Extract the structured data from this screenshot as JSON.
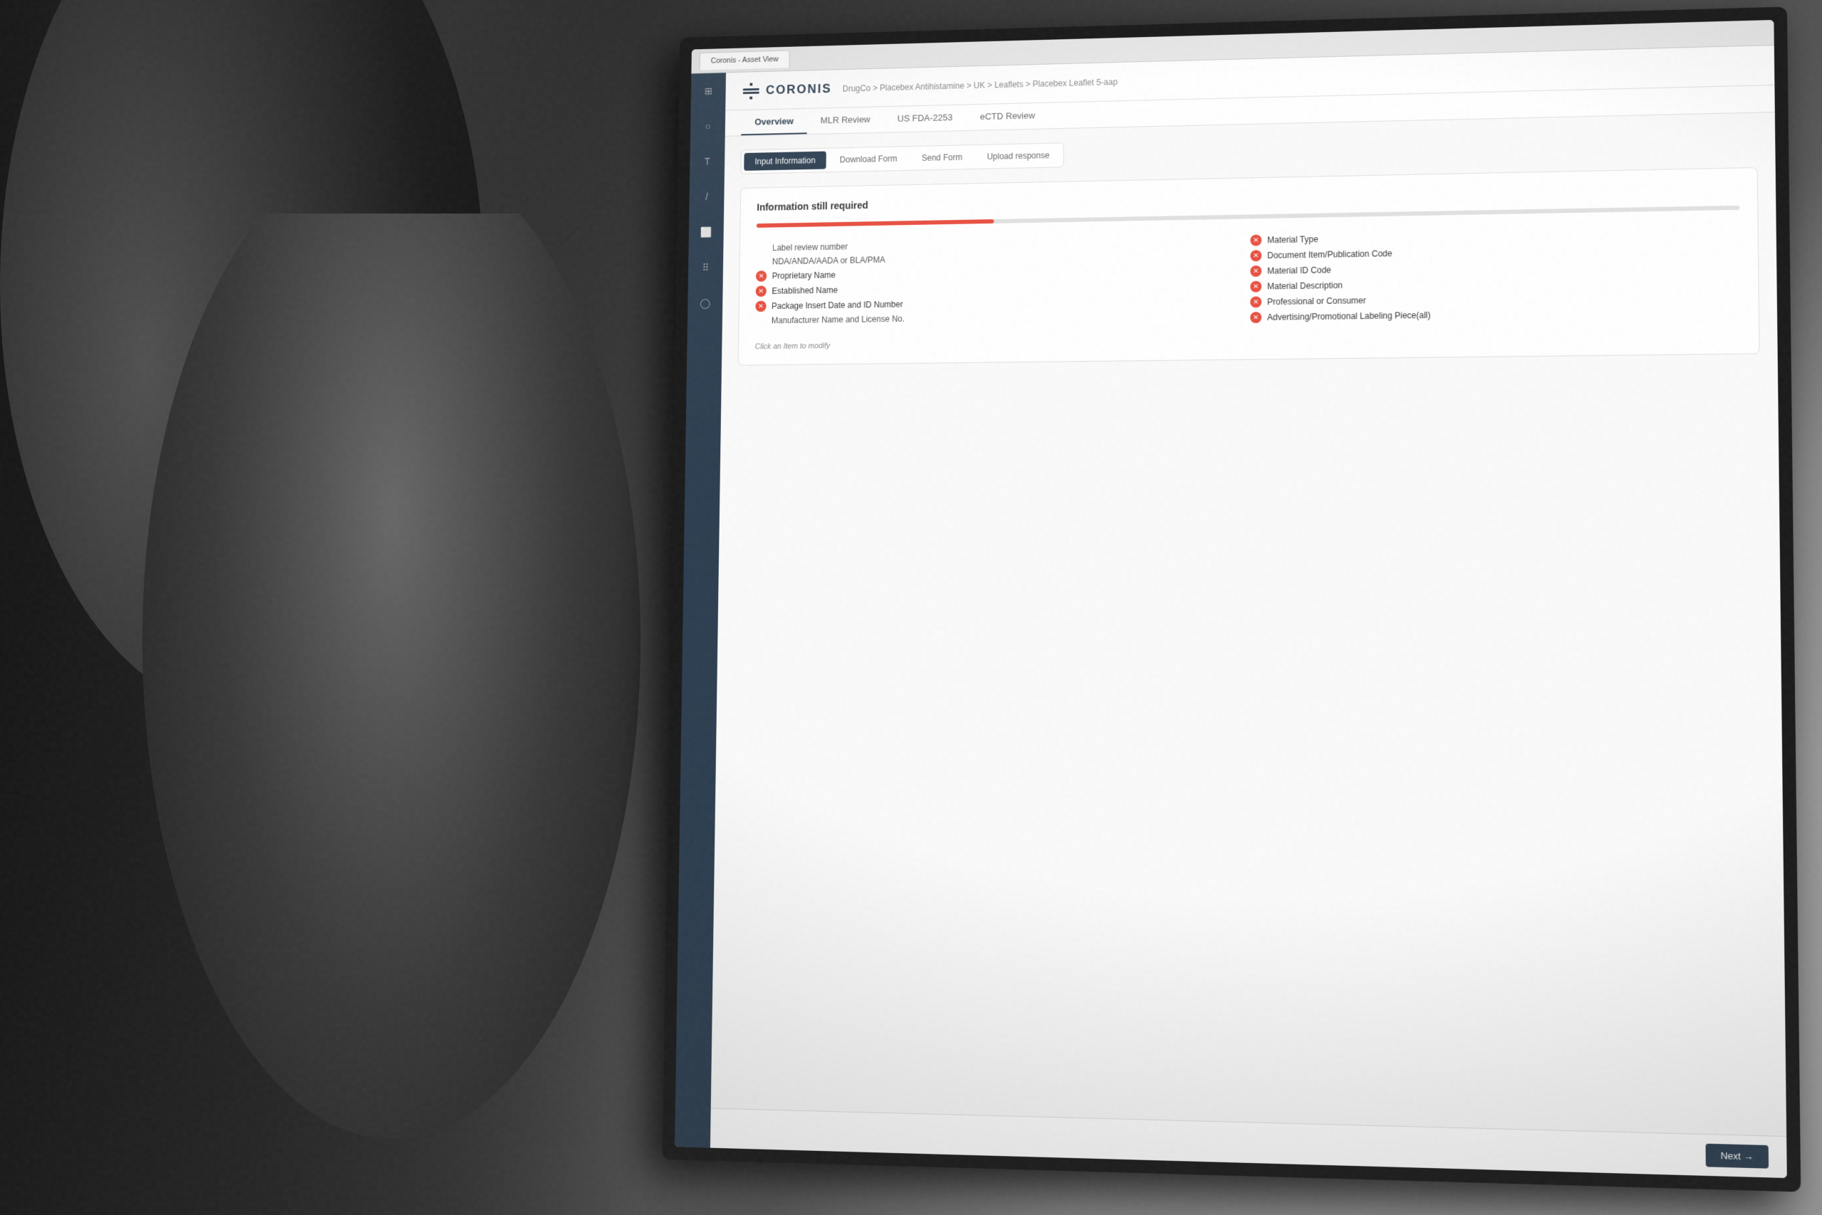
{
  "photo": {
    "alt": "Two people looking at a large monitor showing the Coronis application"
  },
  "browser": {
    "tab_label": "Coronis - Asset View"
  },
  "app": {
    "logo_text": "CORONIS",
    "breadcrumb": "DrugCo > Placebex Antihistamine > UK > Leaflets > Placebex Leaflet 5-aap",
    "breadcrumb_parts": [
      "DrugCo",
      "Placebex Antihistamine",
      "UK",
      "Leaflets",
      "Placebex Leaflet 5-aap"
    ]
  },
  "page_tabs": [
    {
      "label": "Overview",
      "active": true
    },
    {
      "label": "MLR Review",
      "active": false
    },
    {
      "label": "US FDA-2253",
      "active": false
    },
    {
      "label": "eCTD Review",
      "active": false
    }
  ],
  "section_tabs": [
    {
      "label": "Input Information",
      "active": true
    },
    {
      "label": "Download Form",
      "active": false
    },
    {
      "label": "Send Form",
      "active": false
    },
    {
      "label": "Upload response",
      "active": false
    }
  ],
  "info_panel": {
    "title": "Information still required",
    "progress_percent": 25,
    "left_fields": [
      {
        "has_icon": false,
        "label": "Label review number"
      },
      {
        "has_icon": false,
        "label": "NDA/ANDA/AADA or BLA/PMA"
      },
      {
        "has_icon": true,
        "label": "Proprietary Name"
      },
      {
        "has_icon": true,
        "label": "Established Name"
      },
      {
        "has_icon": true,
        "label": "Package Insert Date and ID Number"
      },
      {
        "has_icon": false,
        "label": "Manufacturer Name and License No."
      }
    ],
    "right_fields": [
      {
        "has_icon": true,
        "label": "Material Type"
      },
      {
        "has_icon": true,
        "label": "Document Item/Publication Code"
      },
      {
        "has_icon": true,
        "label": "Material ID Code"
      },
      {
        "has_icon": true,
        "label": "Material Description"
      },
      {
        "has_icon": true,
        "label": "Professional or Consumer"
      },
      {
        "has_icon": true,
        "label": "Advertising/Promotional Labeling Piece(all)"
      }
    ],
    "click_to_modify": "Click an Item to modify"
  },
  "sidebar": {
    "icons": [
      {
        "name": "grid-icon",
        "symbol": "⊞"
      },
      {
        "name": "file-icon",
        "symbol": "○"
      },
      {
        "name": "text-icon",
        "symbol": "T"
      },
      {
        "name": "slash-icon",
        "symbol": "/"
      },
      {
        "name": "image-icon",
        "symbol": "⬜"
      },
      {
        "name": "grid2-icon",
        "symbol": "⠿"
      },
      {
        "name": "circle-icon",
        "symbol": "○"
      }
    ]
  },
  "bottom_button": {
    "label": "Next →"
  }
}
